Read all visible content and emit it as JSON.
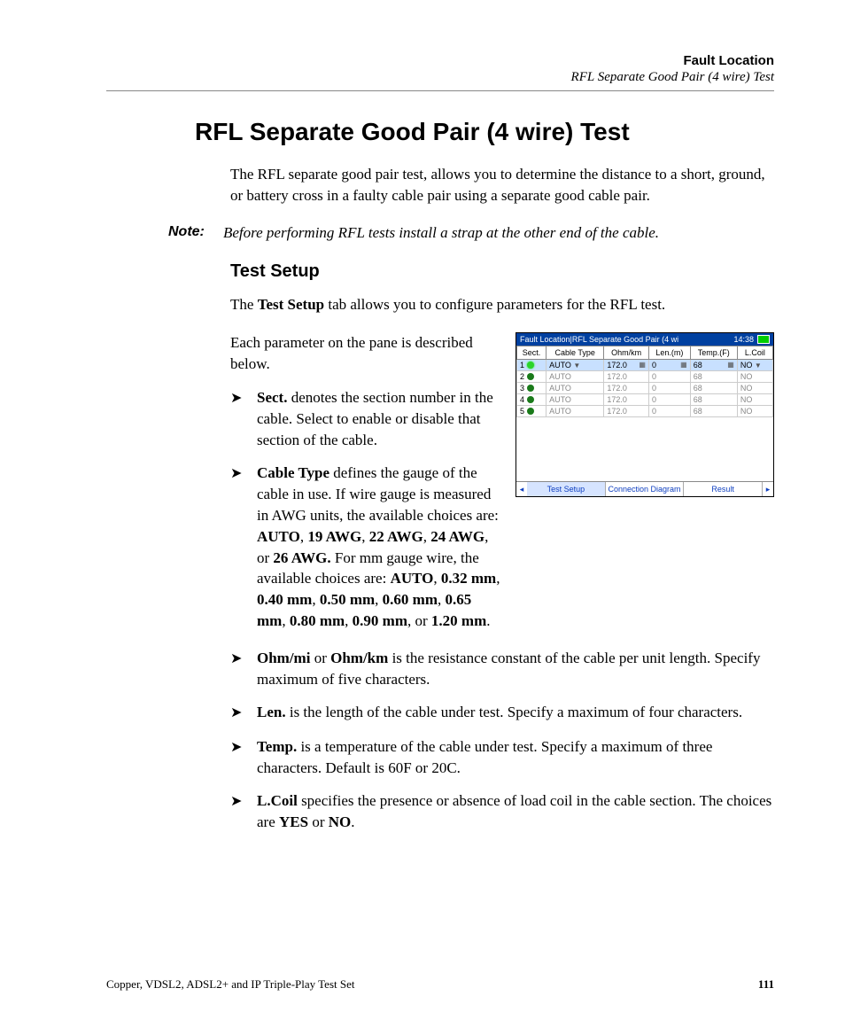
{
  "header": {
    "chapter": "Fault Location",
    "section": "RFL Separate Good Pair (4 wire) Test"
  },
  "h1": "RFL Separate Good Pair (4 wire) Test",
  "intro": "The RFL separate good pair test, allows you to determine the distance to a short, ground, or battery cross in a faulty cable pair using a separate good cable pair.",
  "note_label": "Note:",
  "note_text": "Before performing RFL tests install a strap at the other end of the cable.",
  "h2": "Test Setup",
  "setup_intro_a": "The ",
  "setup_intro_b": "Test Setup",
  "setup_intro_c": " tab allows you to configure parameters for the RFL test.",
  "float_text": "Each parameter on the pane is described below.",
  "bullets": {
    "sect_b": "Sect.",
    "sect_t": " denotes the section number in the cable. Select to enable or disable that section of the cable.",
    "cable_b": "Cable Type",
    "cable_t1": " defines the gauge of the cable in use. If wire gauge is measured in AWG units, the available choices are: ",
    "cable_awg": "AUTO, 19 AWG, 22 AWG, 24 AWG, or 26 AWG.",
    "cable_t2": " For mm gauge wire, the available choices are: ",
    "cable_mm": "AUTO, 0.32 mm, 0.40 mm, 0.50 mm, 0.60 mm, 0.65 mm, 0.80 mm, 0.90 mm, or 1.20 mm",
    "ohm_b1": "Ohm/mi",
    "ohm_or": " or ",
    "ohm_b2": "Ohm/km",
    "ohm_t": " is the resistance constant of the cable per unit length. Specify maximum of five characters.",
    "len_b": "Len.",
    "len_t": " is the length of the cable under test. Specify a maximum of four characters.",
    "temp_b": "Temp.",
    "temp_t": " is a temperature of the cable under test. Specify a maximum of three characters. Default is 60F or 20C.",
    "lcoil_b": "L.Coil",
    "lcoil_t1": " specifies the presence or absence of load coil in the cable section. The choices are ",
    "lcoil_yes": "YES",
    "lcoil_or": " or ",
    "lcoil_no": "NO",
    "period": "."
  },
  "screenshot": {
    "title": "Fault Location|RFL Separate Good Pair (4 wi",
    "time": "14:38",
    "headers": [
      "Sect.",
      "Cable Type",
      "Ohm/km",
      "Len.(m)",
      "Temp.(F)",
      "L.Coil"
    ],
    "rows": [
      {
        "n": "1",
        "on": true,
        "ct": "AUTO",
        "ohm": "172.0",
        "len": "0",
        "temp": "68",
        "lc": "NO"
      },
      {
        "n": "2",
        "on": false,
        "ct": "AUTO",
        "ohm": "172.0",
        "len": "0",
        "temp": "68",
        "lc": "NO"
      },
      {
        "n": "3",
        "on": false,
        "ct": "AUTO",
        "ohm": "172.0",
        "len": "0",
        "temp": "68",
        "lc": "NO"
      },
      {
        "n": "4",
        "on": false,
        "ct": "AUTO",
        "ohm": "172.0",
        "len": "0",
        "temp": "68",
        "lc": "NO"
      },
      {
        "n": "5",
        "on": false,
        "ct": "AUTO",
        "ohm": "172.0",
        "len": "0",
        "temp": "68",
        "lc": "NO"
      }
    ],
    "tabs": [
      "Test Setup",
      "Connection Diagram",
      "Result"
    ]
  },
  "footer": {
    "left": "Copper, VDSL2, ADSL2+ and IP Triple-Play Test Set",
    "page": "111"
  }
}
